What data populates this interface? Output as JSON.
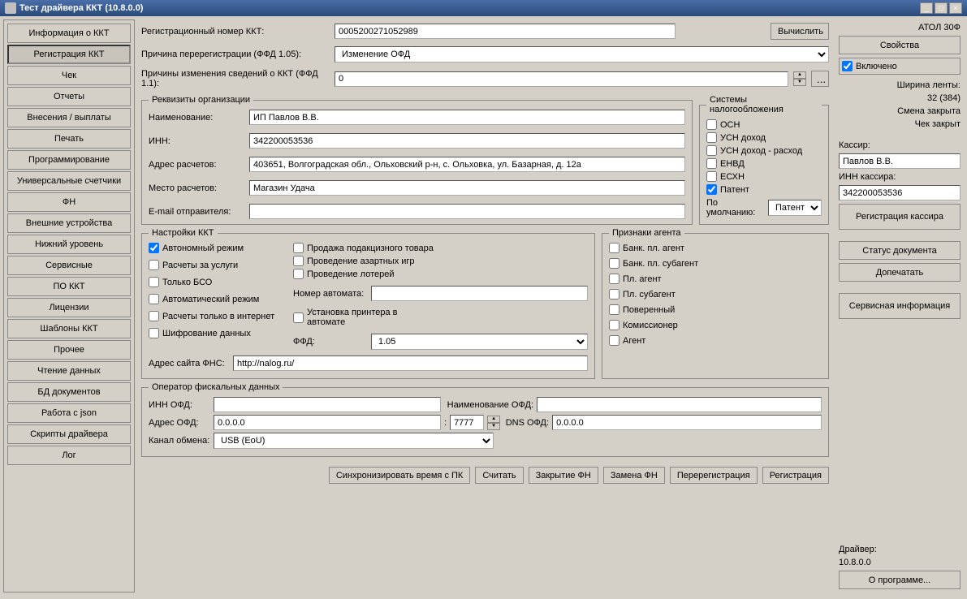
{
  "titlebar": {
    "text": "Тест драйвера ККТ (10.8.0.0)"
  },
  "nav": {
    "items": [
      "Информация о ККТ",
      "Регистрация ККТ",
      "Чек",
      "Отчеты",
      "Внесения / выплаты",
      "Печать",
      "Программирование",
      "Универсальные счетчики",
      "ФН",
      "Внешние устройства",
      "Нижний уровень",
      "Сервисные",
      "ПО ККТ",
      "Лицензии",
      "Шаблоны ККТ",
      "Прочее",
      "Чтение данных",
      "БД документов",
      "Работа с json",
      "Скрипты драйвера",
      "Лог"
    ],
    "active_index": 1
  },
  "top_form": {
    "reg_num_label": "Регистрационный номер ККТ:",
    "reg_num_value": "0005200271052989",
    "calc_btn": "Вычислить",
    "rereg_reason_label": "Причина перерегистрации (ФФД 1.05):",
    "rereg_reason_value": "Изменение ОФД",
    "change_reason_label": "Причины изменения сведений о ККТ (ФФД 1.1):",
    "change_reason_value": "0"
  },
  "org": {
    "legend": "Реквизиты организации",
    "name_label": "Наименование:",
    "name_value": "ИП Павлов В.В.",
    "inn_label": "ИНН:",
    "inn_value": "342200053536",
    "addr_label": "Адрес расчетов:",
    "addr_value": "403651, Волгоградская обл., Ольховский р-н, с. Ольховка, ул. Базарная, д. 12а",
    "place_label": "Место расчетов:",
    "place_value": "Магазин Удача",
    "email_label": "E-mail отправителя:",
    "email_value": ""
  },
  "tax": {
    "legend": "Системы налогообложения",
    "items": [
      "ОСН",
      "УСН доход",
      "УСН доход - расход",
      "ЕНВД",
      "ЕСХН",
      "Патент"
    ],
    "checked": {
      "Патент": true
    },
    "default_label": "По умолчанию:",
    "default_value": "Патент"
  },
  "kkt": {
    "legend": "Настройки ККТ",
    "col1": [
      {
        "label": "Автономный режим",
        "checked": true
      },
      {
        "label": "Расчеты за услуги",
        "checked": false
      },
      {
        "label": "Только БСО",
        "checked": false
      },
      {
        "label": "Автоматический режим",
        "checked": false
      },
      {
        "label": "Расчеты только в интернет",
        "checked": false
      },
      {
        "label": "Шифрование данных",
        "checked": false
      }
    ],
    "col2": [
      {
        "label": "Продажа подакцизного товара",
        "checked": false
      },
      {
        "label": "Проведение азартных игр",
        "checked": false
      },
      {
        "label": "Проведение лотерей",
        "checked": false
      }
    ],
    "automat_label": "Номер автомата:",
    "automat_value": "",
    "printer_label": "Установка принтера в автомате",
    "printer_checked": false,
    "ffd_label": "ФФД:",
    "ffd_value": "1.05",
    "fns_label": "Адрес сайта ФНС:",
    "fns_value": "http://nalog.ru/"
  },
  "agent": {
    "legend": "Признаки агента",
    "items": [
      {
        "label": "Банк. пл. агент",
        "checked": false
      },
      {
        "label": "Банк. пл. субагент",
        "checked": false
      },
      {
        "label": "Пл. агент",
        "checked": false
      },
      {
        "label": "Пл. субагент",
        "checked": false
      },
      {
        "label": "Поверенный",
        "checked": false
      },
      {
        "label": "Комиссионер",
        "checked": false
      },
      {
        "label": "Агент",
        "checked": false
      }
    ]
  },
  "ofd": {
    "legend": "Оператор фискальных данных",
    "inn_label": "ИНН ОФД:",
    "inn_value": "",
    "name_label": "Наименование ОФД:",
    "name_value": "",
    "addr_label": "Адрес ОФД:",
    "addr_value": "0.0.0.0",
    "port_value": "7777",
    "dns_label": "DNS ОФД:",
    "dns_value": "0.0.0.0",
    "channel_label": "Канал обмена:",
    "channel_value": "USB (EoU)"
  },
  "bottom_btns": [
    "Синхронизировать время с ПК",
    "Считать",
    "Закрытие ФН",
    "Замена ФН",
    "Перерегистрация",
    "Регистрация"
  ],
  "right": {
    "device": "АТОЛ 30Ф",
    "props_btn": "Свойства",
    "enabled_label": "Включено",
    "enabled_checked": true,
    "tape_label": "Ширина ленты:",
    "tape_value": "32 (384)",
    "shift_status": "Смена закрыта",
    "check_status": "Чек закрыт",
    "cashier_label": "Кассир:",
    "cashier_value": "Павлов В.В.",
    "cashier_inn_label": "ИНН кассира:",
    "cashier_inn_value": "342200053536",
    "reg_cashier_btn": "Регистрация кассира",
    "doc_status_btn": "Статус документа",
    "print_btn": "Допечатать",
    "service_btn": "Сервисная информация",
    "driver_label": "Драйвер:",
    "driver_value": "10.8.0.0",
    "about_btn": "О программе..."
  }
}
